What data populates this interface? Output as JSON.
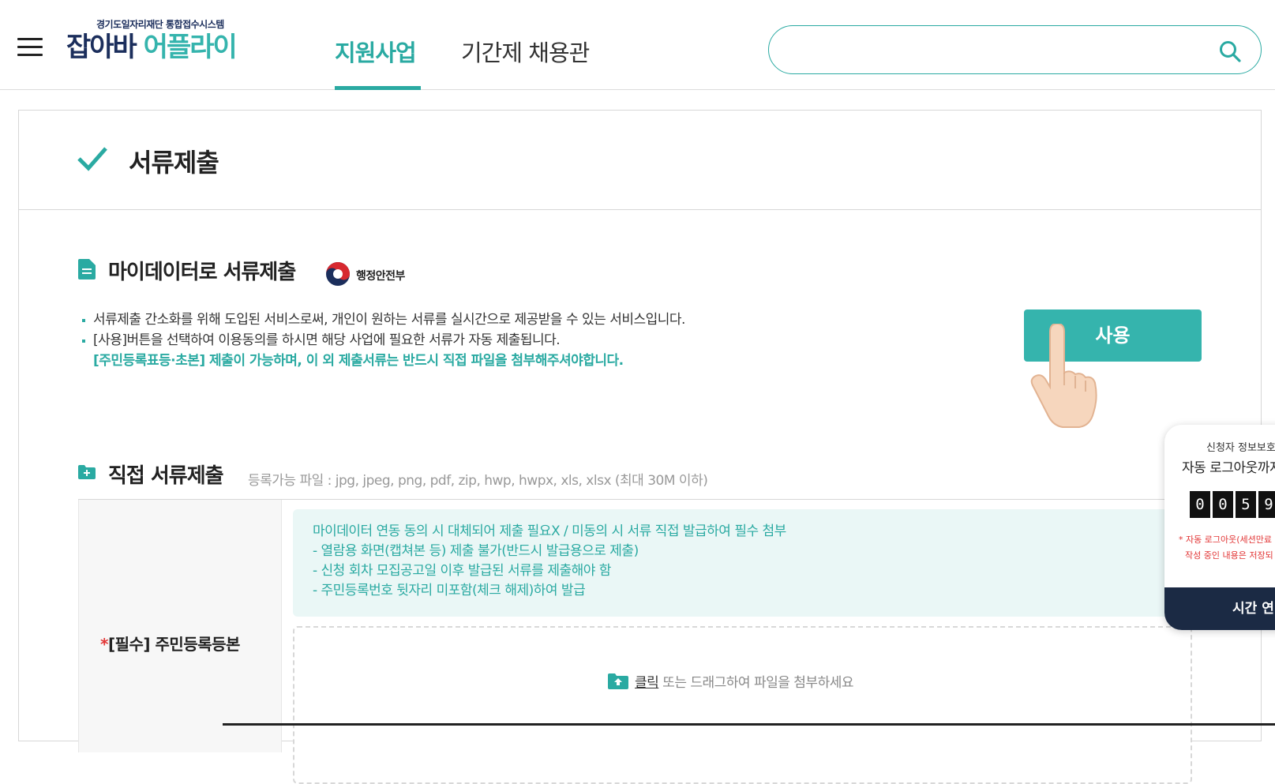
{
  "header": {
    "logo_sub": "경기도일자리재단 통합접수시스템",
    "logo_main_dark": "잡아바",
    "logo_main_teal": " 어플라이",
    "tabs": [
      {
        "label": "지원사업",
        "active": true
      },
      {
        "label": "기간제 채용관",
        "active": false
      }
    ],
    "search_placeholder": ""
  },
  "page": {
    "title": "서류제출"
  },
  "mydata": {
    "title": "마이데이터로 서류제출",
    "gov_name": "행정안전부",
    "bullets": [
      "서류제출 간소화를 위해 도입된 서비스로써, 개인이 원하는 서류를 실시간으로 제공받을 수 있는 서비스입니다.",
      "[사용]버튼을 선택하여 이용동의를 하시면 해당 사업에 필요한 서류가 자동 제출됩니다."
    ],
    "highlight": "[주민등록표등·초본] 제출이 가능하며, 이 외 제출서류는 반드시 직접 파일을 첨부해주셔야합니다.",
    "use_button": "사용"
  },
  "direct": {
    "title": "직접 서류제출",
    "note": "등록가능 파일 : jpg, jpeg, png, pdf, zip, hwp, hwpx, xls, xlsx (최대 30M 이하)",
    "row_label_star": "*",
    "row_label": "[필수] 주민등록등본",
    "info_lines": [
      "마이데이터 연동 동의 시 대체되어 제출 필요X / 미동의 시 서류 직접 발급하여 필수 첨부",
      "- 열람용 화면(캡쳐본 등) 제출 불가(반드시 발급용으로 제출)",
      "- 신청 회차 모집공고일 이후 발급된 서류를 제출해야 함",
      "- 주민등록번호 뒷자리 미포함(체크 해제)하여 발급"
    ],
    "drop_click": "클릭",
    "drop_text": " 또는 드래그하여 파일을 첨부하세요"
  },
  "session_popup": {
    "subtitle": "신청자 정보보호",
    "title": "자동 로그아웃까지",
    "digits": [
      "0",
      "0",
      "5",
      "9"
    ],
    "warn_line1": "* 자동 로그아웃(세션만료",
    "warn_line2": "작성 중인 내용은 저장되",
    "button": "시간 연"
  },
  "colors": {
    "accent": "#2aaaa2",
    "button": "#35b4ad",
    "brand_dark": "#1b2e5c",
    "popup_button": "#1b2a44",
    "warn": "#e23636"
  }
}
